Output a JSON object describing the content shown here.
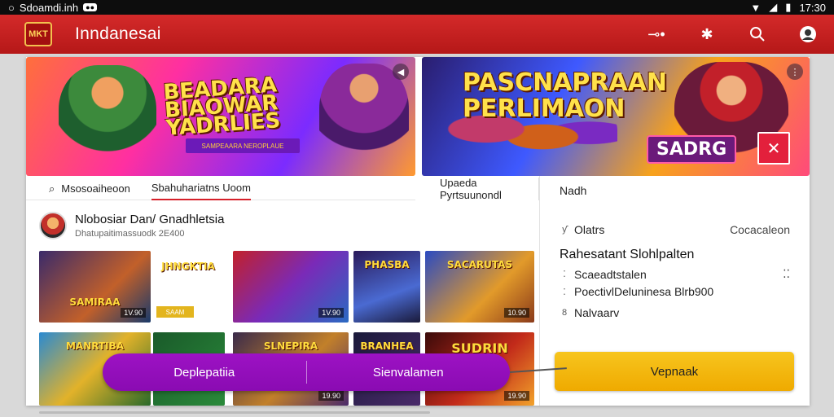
{
  "status_bar": {
    "left_text": "Sdoamdi.inh",
    "time": "17:30"
  },
  "app_bar": {
    "logo_text": "MKT",
    "title": "Inndanesai"
  },
  "banners": [
    {
      "title": "BEADARA BIAOWAR YADRLIES",
      "subtitle": "SAMPEAARA NEROPLAUE"
    },
    {
      "title": "PASCNAPRAAN PERLIMAON",
      "badge": "SADRG"
    }
  ],
  "tabs_left": {
    "search_icon": "search-icon",
    "tab1": "Msosoaiheoon",
    "tab2": "Sbahuhariatns Uoom"
  },
  "tabs_right": {
    "tab": "Upaeda Pyrtsuunondl"
  },
  "section": {
    "title": "Nlobosiar Dan/ Gnadhletsia",
    "subtitle": "Dhatupaitimassuodk 2E400"
  },
  "thumbs": [
    {
      "label": "SAMIRAA",
      "price": "1V.90"
    },
    {
      "label": "JHNGKTIA",
      "tag": "SAAM"
    },
    {
      "label": "",
      "price": "1V.90"
    },
    {
      "label": "PHASBA",
      "price": ""
    },
    {
      "label": "SACARUTAS",
      "price": "10.90"
    },
    {
      "label": "MANRTIBA",
      "price": ""
    },
    {
      "label": "",
      "price": ""
    },
    {
      "label": "SLNEPIRA",
      "price": "19.90"
    },
    {
      "label": "BRANHEA",
      "price": ""
    },
    {
      "label": "SUDRIN",
      "price": "19.90"
    }
  ],
  "side_panel": {
    "head": "Nadh",
    "row1_label": "Olatrs",
    "row1_value": "Cocacaleon",
    "section_title": "Rahesatant Slohlpalten",
    "row2_label": "Scaeadtstalen",
    "row2_value": "",
    "row3_label": "PoectivlDeluninesa Blrb900",
    "row4_label": "Nalvaarv",
    "cta_label": "Vepnaak"
  },
  "floating_bar": {
    "left_label": "Deplepatiia",
    "right_label": "Sienvalamen"
  },
  "colors": {
    "brand_red": "#c41f1f",
    "cta_yellow": "#f3b90f",
    "purple": "#9510bd"
  }
}
